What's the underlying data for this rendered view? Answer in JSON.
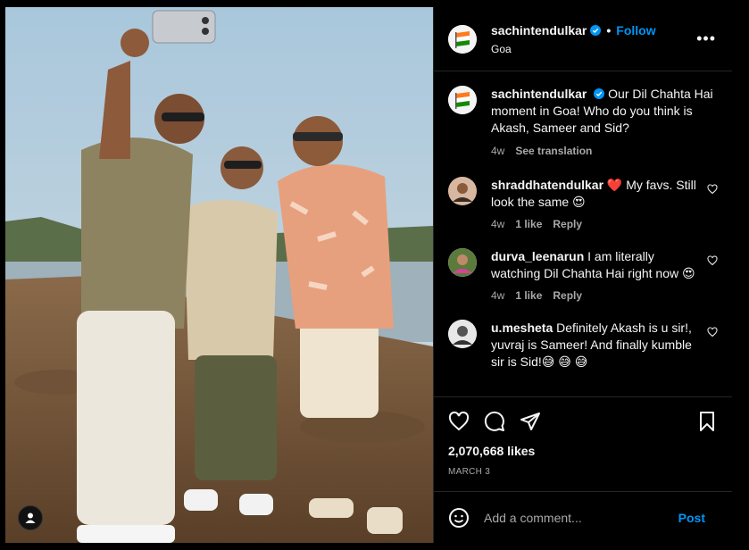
{
  "post": {
    "username": "sachintendulkar",
    "follow_label": "Follow",
    "separator": "•",
    "location": "Goa",
    "more_label": "•••",
    "caption": "Our Dil Chahta Hai moment in Goa! Who do you think is Akash, Sameer and Sid?",
    "caption_time": "4w",
    "see_translation": "See translation",
    "likes": "2,070,668 likes",
    "date": "MARCH 3"
  },
  "comments": [
    {
      "user": "shraddhatendulkar",
      "text": "❤️ My favs. Still look the same 😍",
      "time": "4w",
      "likes": "1 like",
      "reply": "Reply"
    },
    {
      "user": "durva_leenarun",
      "text": "I am literally watching Dil Chahta Hai right now 😍",
      "time": "4w",
      "likes": "1 like",
      "reply": "Reply"
    },
    {
      "user": "u.mesheta",
      "text": "Definitely Akash is u sir!, yuvraj is Sameer! And finally kumble sir is Sid!😅 😅 😅"
    }
  ],
  "add_comment": {
    "placeholder": "Add a comment...",
    "post_label": "Post"
  },
  "icons": {
    "like": "heart-icon",
    "comment": "comment-icon",
    "share": "share-icon",
    "save": "bookmark-icon",
    "verified": "verified-badge-icon",
    "emoji": "emoji-icon",
    "tag": "user-tag-icon"
  },
  "colors": {
    "accent": "#0095f6",
    "background": "#000000",
    "muted_text": "#a8a8a8",
    "heart_red": "#ed4956"
  }
}
